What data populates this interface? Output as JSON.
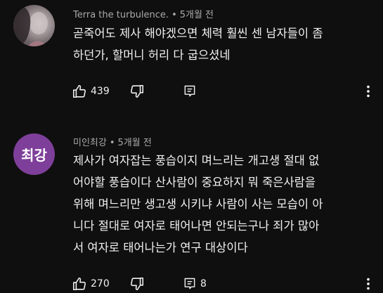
{
  "comments": [
    {
      "author": "Terra the turbulence.",
      "separator": "•",
      "time": "5개월 전",
      "avatar_type": "photo",
      "lines": [
        "곧죽어도 제사 해야겠으면 체력 훨씬 센 남자들이 좀",
        "하던가, 할머니 허리 다 굽으셨네"
      ],
      "likes": "439",
      "replies": ""
    },
    {
      "author": "미인최강",
      "separator": "•",
      "time": "5개월 전",
      "avatar_type": "text",
      "avatar_text": "최강",
      "avatar_color": "#7e3f9a",
      "lines": [
        "제사가 여자잡는 풍습이지 며느리는 개고생 절대 없",
        "어야할 풍습이다 산사람이 중요하지 뭐 죽은사람을",
        "위해 며느리만 생고생 시키냐 사람이 사는 모습이 아",
        "니다 절대로 여자로 태어나면 안되는구나 죄가 많아",
        "서 여자로 태어나는가 연구 대상이다"
      ],
      "likes": "270",
      "replies": "8"
    }
  ],
  "icons": {
    "like": "thumb-up-icon",
    "dislike": "thumb-down-icon",
    "reply": "reply-comment-icon",
    "more": "more-vertical-icon"
  }
}
